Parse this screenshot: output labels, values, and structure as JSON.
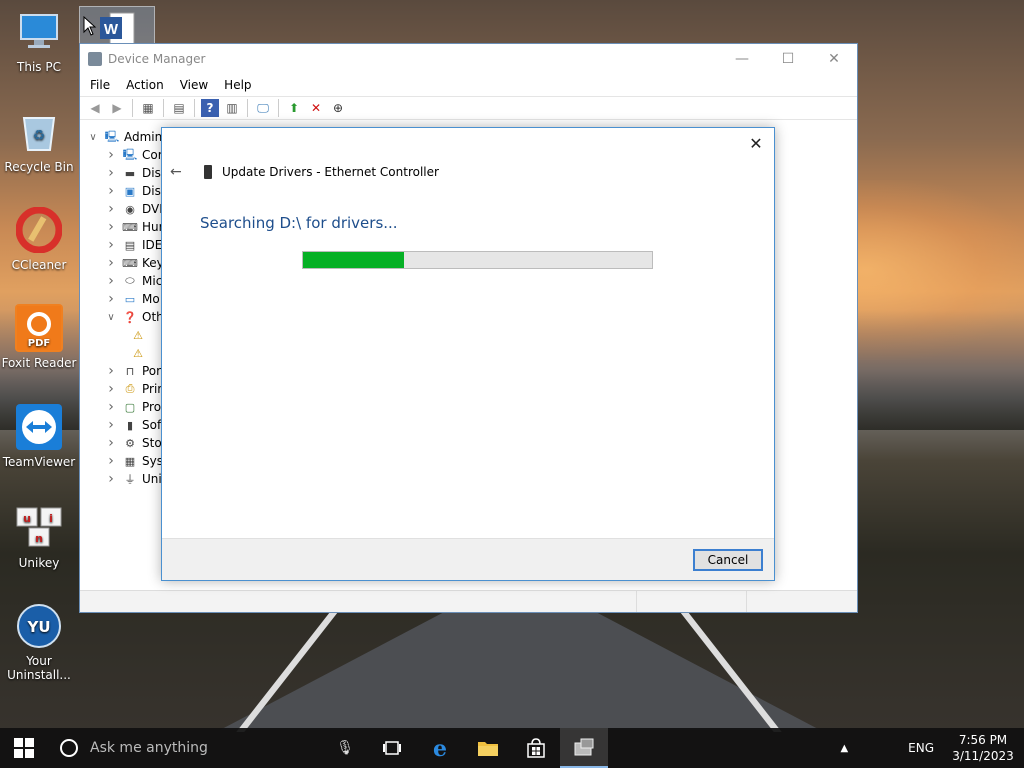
{
  "desktop": {
    "icons": [
      {
        "label": "This PC"
      },
      {
        "label": "Recycle Bin"
      },
      {
        "label": "CCleaner"
      },
      {
        "label": "Foxit Reader"
      },
      {
        "label": "TeamViewer"
      },
      {
        "label": "Unikey"
      },
      {
        "label": "Your Uninstall..."
      }
    ],
    "selected_icon_glyph": "W"
  },
  "device_manager": {
    "title": "Device Manager",
    "menu": [
      "File",
      "Action",
      "View",
      "Help"
    ],
    "tree": [
      {
        "label": "Admin",
        "icon": "computer-icon",
        "expanded": true,
        "level": 0
      },
      {
        "label": "Cor",
        "icon": "computer-icon",
        "level": 1
      },
      {
        "label": "Disl",
        "icon": "disk-drive-icon",
        "level": 1
      },
      {
        "label": "Disp",
        "icon": "display-adapter-icon",
        "level": 1
      },
      {
        "label": "DVD",
        "icon": "dvd-icon",
        "level": 1
      },
      {
        "label": "Hur",
        "icon": "hid-icon",
        "level": 1
      },
      {
        "label": "IDE",
        "icon": "ide-icon",
        "level": 1
      },
      {
        "label": "Key",
        "icon": "keyboard-icon",
        "level": 1
      },
      {
        "label": "Mic",
        "icon": "mouse-icon",
        "level": 1
      },
      {
        "label": "Mo",
        "icon": "monitor-icon",
        "level": 1
      },
      {
        "label": "Oth",
        "icon": "other-devices-icon",
        "level": 1,
        "expanded": true
      },
      {
        "label": "",
        "icon": "warning-device-icon",
        "level": 2
      },
      {
        "label": "",
        "icon": "warning-device-icon",
        "level": 2
      },
      {
        "label": "Por",
        "icon": "port-icon",
        "level": 1
      },
      {
        "label": "Prir",
        "icon": "print-queue-icon",
        "level": 1
      },
      {
        "label": "Pro",
        "icon": "processor-icon",
        "level": 1
      },
      {
        "label": "Sof",
        "icon": "software-device-icon",
        "level": 1
      },
      {
        "label": "Sto",
        "icon": "storage-icon",
        "level": 1
      },
      {
        "label": "Syst",
        "icon": "system-devices-icon",
        "level": 1
      },
      {
        "label": "Uni",
        "icon": "usb-icon",
        "level": 1
      }
    ]
  },
  "dialog": {
    "title": "Update Drivers - Ethernet Controller",
    "heading": "Searching D:\\ for drivers...",
    "progress": 0.29,
    "cancel_label": "Cancel",
    "close_glyph": "✕",
    "back_glyph": "←"
  },
  "taskbar": {
    "search_placeholder": "Ask me anything",
    "language": "ENG",
    "time": "7:56 PM",
    "date": "3/11/2023"
  },
  "colors": {
    "accent": "#1e4e8c",
    "progress_fill": "#06b025",
    "dialog_border": "#4a90d0"
  }
}
